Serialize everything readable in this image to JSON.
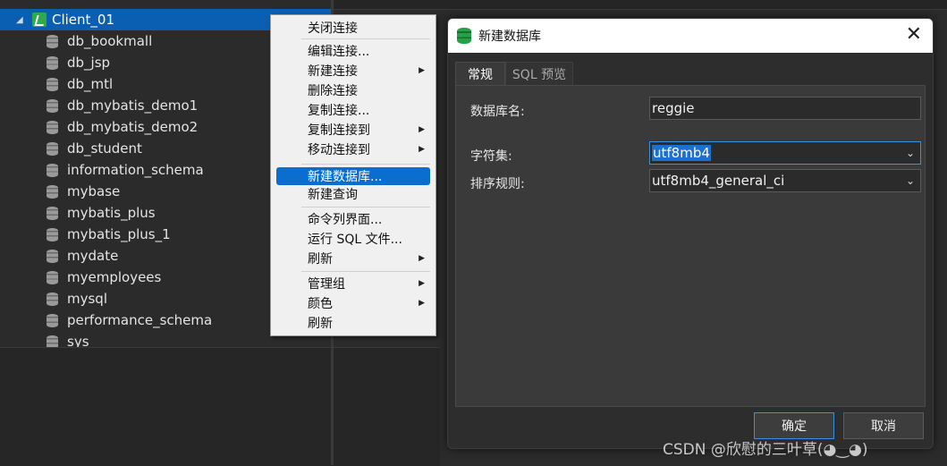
{
  "tree": {
    "connection": "Client_01",
    "databases": [
      "db_bookmall",
      "db_jsp",
      "db_mtl",
      "db_mybatis_demo1",
      "db_mybatis_demo2",
      "db_student",
      "information_schema",
      "mybase",
      "mybatis_plus",
      "mybatis_plus_1",
      "mydate",
      "myemployees",
      "mysql",
      "performance_schema",
      "sys"
    ]
  },
  "context_menu": {
    "items": [
      {
        "label": "关闭连接",
        "submenu": false
      },
      {
        "label": "编辑连接...",
        "submenu": false
      },
      {
        "label": "新建连接",
        "submenu": true
      },
      {
        "label": "删除连接",
        "submenu": false
      },
      {
        "label": "复制连接...",
        "submenu": false
      },
      {
        "label": "复制连接到",
        "submenu": true
      },
      {
        "label": "移动连接到",
        "submenu": true
      },
      {
        "label": "新建数据库...",
        "submenu": false,
        "selected": true
      },
      {
        "label": "新建查询",
        "submenu": false
      },
      {
        "label": "命令列界面...",
        "submenu": false
      },
      {
        "label": "运行 SQL 文件...",
        "submenu": false
      },
      {
        "label": "刷新",
        "submenu": true
      },
      {
        "label": "管理组",
        "submenu": true
      },
      {
        "label": "颜色",
        "submenu": true
      },
      {
        "label": "刷新",
        "submenu": false
      }
    ]
  },
  "dialog": {
    "title": "新建数据库",
    "tabs": [
      "常规",
      "SQL 预览"
    ],
    "fields": {
      "db_name_label": "数据库名:",
      "db_name_value": "reggie",
      "charset_label": "字符集:",
      "charset_value": "utf8mb4",
      "collation_label": "排序规则:",
      "collation_value": "utf8mb4_general_ci"
    },
    "ok_label": "确定",
    "cancel_label": "取消"
  },
  "watermark": "CSDN @欣慰的三叶草(◕‿◕)",
  "colors": {
    "selection": "#0a5fb3",
    "menu_highlight": "#0a6ed1",
    "connection_icon": "#2fa84f",
    "title_icon": "#27a148"
  }
}
